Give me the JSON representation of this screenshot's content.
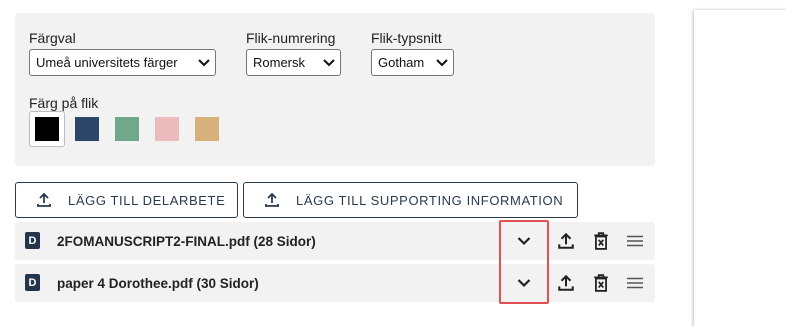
{
  "settings": {
    "color_choice": {
      "label": "Färgval",
      "value": "Umeå universitets färger"
    },
    "tab_numbering": {
      "label": "Flik-numrering",
      "value": "Romersk"
    },
    "tab_font": {
      "label": "Flik-typsnitt",
      "value": "Gotham"
    },
    "tab_color": {
      "label": "Färg på flik",
      "swatches": [
        "#000000",
        "#2b4669",
        "#6fa88a",
        "#ecbcbc",
        "#d8b07a"
      ],
      "selected_index": 0
    }
  },
  "actions": {
    "add_subwork": "LÄGG TILL DELARBETE",
    "add_supporting": "LÄGG TILL SUPPORTING INFORMATION"
  },
  "files": [
    {
      "badge": "D",
      "name": "2FOMANUSCRIPT2-FINAL.pdf (28 Sidor)"
    },
    {
      "badge": "D",
      "name": "paper 4 Dorothee.pdf (30 Sidor)"
    }
  ],
  "colors": {
    "accent": "#24344d",
    "highlight": "#e05252",
    "panel": "#f2f2f2"
  }
}
